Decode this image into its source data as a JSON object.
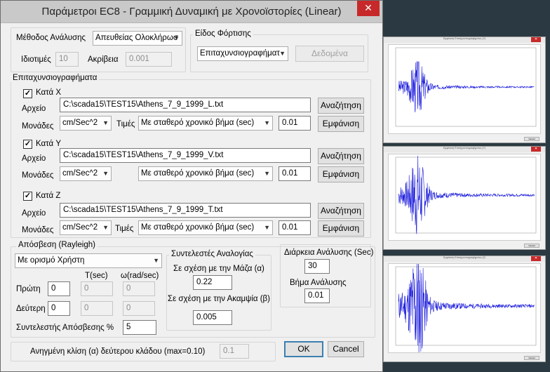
{
  "dialog": {
    "title": "Παράμετροι EC8 - Γραμμική Δυναμική με Χρονοϊστορίες (Linear)",
    "close_symbol": "✕"
  },
  "analysis": {
    "method_label": "Μέθοδος Ανάλυσης",
    "method_value": "Απευθείας Ολοκλήρωσ",
    "eigen_label": "Ιδιοτιμές",
    "eigen_value": "10",
    "accuracy_label": "Ακρίβεια",
    "accuracy_value": "0.001"
  },
  "load_type": {
    "title": "Είδος Φόρτισης",
    "value": "Επιταχυνσιογραφήματ",
    "data_button": "Δεδομένα"
  },
  "accelerograms": {
    "title": "Επιταχυνσιογραφήματα",
    "file_label": "Αρχείο",
    "units_label": "Μονάδες",
    "values_label": "Τιμές",
    "search_button": "Αναζήτηση",
    "show_button": "Εμφάνιση",
    "axes": [
      {
        "check": "✓",
        "label": "Κατά X",
        "file": "C:\\scada15\\TEST15\\Athens_7_9_1999_L.txt",
        "units": "cm/Sec^2",
        "values": "Με σταθερό χρονικό βήμα (sec)",
        "step": "0.01"
      },
      {
        "check": "✓",
        "label": "Κατά Y",
        "file": "C:\\scada15\\TEST15\\Athens_7_9_1999_V.txt",
        "units": "cm/Sec^2",
        "values": "Με σταθερό χρονικό βήμα (sec)",
        "step": "0.01"
      },
      {
        "check": "✓",
        "label": "Κατά Z",
        "file": "C:\\scada15\\TEST15\\Athens_7_9_1999_T.txt",
        "units": "cm/Sec^2",
        "values": "Με σταθερό χρονικό βήμα (sec)",
        "step": "0.01"
      }
    ]
  },
  "damping": {
    "title": "Απόσβεση (Rayleigh)",
    "mode_value": "Με ορισμό Χρήστη",
    "t_header": "T(sec)",
    "w_header": "ω(rad/sec)",
    "first_label": "Πρώτη",
    "first_value": "0",
    "first_t": "0",
    "first_w": "0",
    "second_label": "Δεύτερη",
    "second_value": "0",
    "second_t": "0",
    "second_w": "0",
    "coef_label": "Συντελεστής Απόσβεσης %",
    "coef_value": "5"
  },
  "proportional": {
    "title": "Συντελεστές Αναλογίας",
    "mass_label": "Σε σχέση με την Μάζα (α)",
    "mass_value": "0.22",
    "stiff_label": "Σε σχέση με την Ακαμψία (β)",
    "stiff_value": "0.005"
  },
  "duration": {
    "duration_label": "Διάρκεια Ανάλυσης (Sec)",
    "duration_value": "30",
    "step_label": "Βήμα Ανάλυσης",
    "step_value": "0.01"
  },
  "reduced_slope": {
    "label": "Ανηγμένη κλίση (α) δεύτερου κλάδου (max=0.10)",
    "value": "0.1"
  },
  "footer": {
    "ok": "OK",
    "cancel": "Cancel"
  },
  "colors": {
    "signal": "#1a1adb",
    "dialog_bg": "#f0f0f0",
    "close_red": "#c7292a",
    "desktop": "#2b3a42"
  },
  "plot_windows": [
    {
      "title": "Εμφάνιση Επιταχυνσιογραφήματος (X)",
      "close": "✕",
      "cancel": "Cancel",
      "seed": 3,
      "peak": 0.35
    },
    {
      "title": "Εμφάνιση Επιταχυνσιογραφήματος (Y)",
      "close": "✕",
      "cancel": "Cancel",
      "seed": 7,
      "peak": 0.55
    },
    {
      "title": "Εμφάνιση Επιταχυνσιογραφήματος (Z)",
      "close": "✕",
      "cancel": "Cancel",
      "seed": 11,
      "peak": 0.75
    }
  ]
}
